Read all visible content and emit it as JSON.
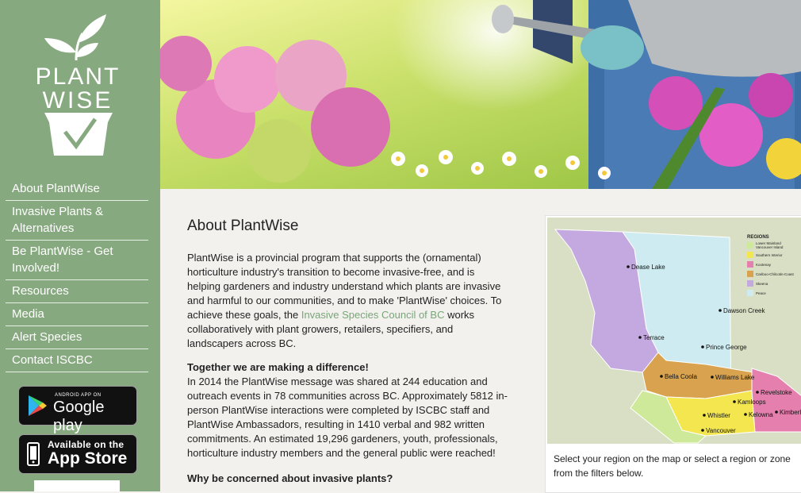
{
  "logo": {
    "line1": "PLANT",
    "line2": "WISE"
  },
  "nav": {
    "items": [
      "About PlantWise",
      "Invasive Plants & Alternatives",
      "Be PlantWise - Get Involved!",
      "Resources",
      "Media",
      "Alert Species",
      "Contact ISCBC"
    ]
  },
  "badges": {
    "google_small": "ANDROID APP ON",
    "google_big": "Google play",
    "apple_small": "Available on the",
    "apple_big": "App Store"
  },
  "main": {
    "title": "About PlantWise",
    "intro_before": "PlantWise is a provincial program that supports the (ornamental) horticulture industry's transition to become invasive-free, and is helping gardeners and industry understand which plants are invasive and harmful to our communities, and to make 'PlantWise' choices. To achieve these goals, the ",
    "intro_link": "Invasive Species Council of BC",
    "intro_after": " works collaboratively with plant growers, retailers, specifiers, and landscapers across BC.",
    "sec1_heading": "Together we are making a difference!",
    "sec1_body": "In 2014 the PlantWise message was shared at 244 education and outreach events in 78 communities across BC. Approximately 5812 in-person PlantWise interactions were completed by ISCBC staff and PlantWise Ambassadors, resulting in 1410 verbal and 982 written commitments. An estimated 19,296 gardeners, youth, professionals, horticulture industry members and the general public were reached!",
    "sec2_heading": "Why be concerned about invasive plants?"
  },
  "map": {
    "legend_title": "REGIONS",
    "regions": [
      {
        "label": "Lower Mainland\nVancouver Island",
        "color": "#cfe99a"
      },
      {
        "label": "Southern Interior",
        "color": "#f3e64e"
      },
      {
        "label": "Kootenay",
        "color": "#e57fae"
      },
      {
        "label": "Cariboo-Chilcotin-Coast",
        "color": "#d8a24e"
      },
      {
        "label": "Skeena",
        "color": "#c4a9e0"
      },
      {
        "label": "Peace",
        "color": "#cdebf0"
      }
    ],
    "cities": [
      "Dease Lake",
      "Dawson Creek",
      "Terrace",
      "Prince George",
      "Bella Coola",
      "Williams Lake",
      "Revelstoke",
      "Kamloops",
      "Whistler",
      "Kelowna",
      "Kimberley",
      "Vancouver"
    ],
    "caption": "Select your region on the map or select a region or zone from the filters below."
  },
  "colors": {
    "sidebar": "#87a97f",
    "link": "#7aa579",
    "text": "#222222"
  }
}
